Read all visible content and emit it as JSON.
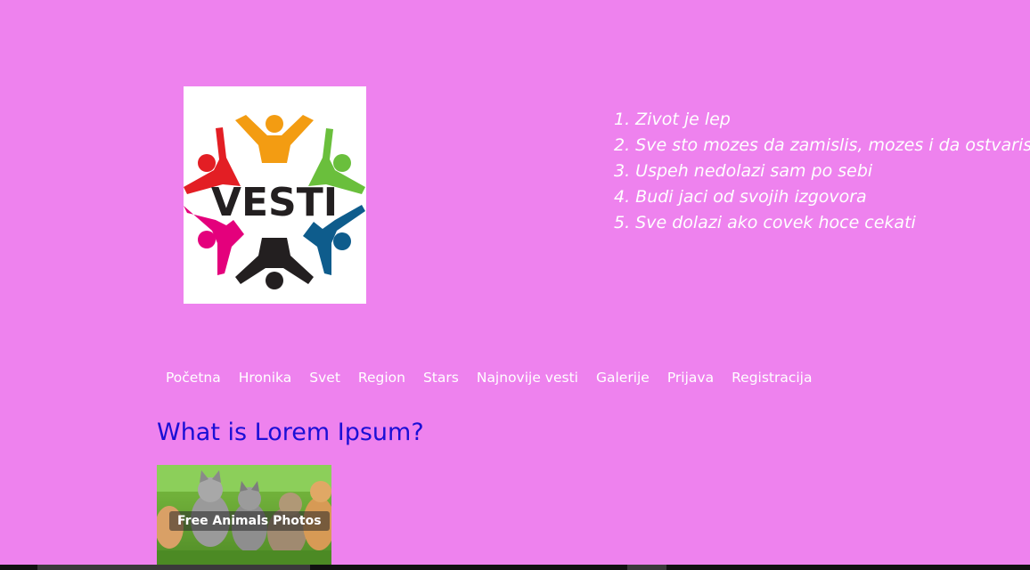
{
  "logo": {
    "text": "VESTI",
    "colors": [
      "#f39c12",
      "#6abf3c",
      "#0e5c8c",
      "#231f20",
      "#e4007c",
      "#e31e24"
    ]
  },
  "quotes": [
    "1. Zivot je lep",
    "2. Sve sto mozes da zamislis, mozes i da ostvaris",
    "3. Uspeh nedolazi sam po sebi",
    "4. Budi jaci od svojih izgovora",
    "5. Sve dolazi ako covek hoce cekati"
  ],
  "nav": [
    "Početna",
    "Hronika",
    "Svet",
    "Region",
    "Stars",
    "Najnovije vesti",
    "Galerije",
    "Prijava",
    "Registracija"
  ],
  "article": {
    "title": "What is Lorem Ipsum?",
    "image_caption": "Free Animals Photos"
  },
  "colors": {
    "background": "#ee82ee",
    "heading": "#1a0fd6",
    "text": "#ffffff"
  }
}
